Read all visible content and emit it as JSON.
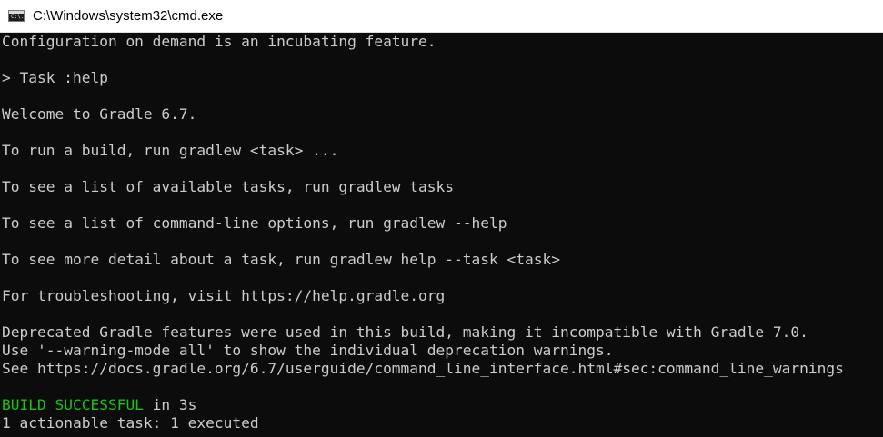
{
  "window": {
    "title": "C:\\Windows\\system32\\cmd.exe",
    "icon": "cmd-console-icon",
    "icon_text": "C:\\."
  },
  "console": {
    "lines": [
      "Configuration on demand is an incubating feature.",
      "> Task :help",
      "Welcome to Gradle 6.7.",
      "To run a build, run gradlew <task> ...",
      "To see a list of available tasks, run gradlew tasks",
      "To see a list of command-line options, run gradlew --help",
      "To see more detail about a task, run gradlew help --task <task>",
      "For troubleshooting, visit https://help.gradle.org",
      "Deprecated Gradle features were used in this build, making it incompatible with Gradle 7.0.",
      "Use '--warning-mode all' to show the individual deprecation warnings.",
      "See https://docs.gradle.org/6.7/userguide/command_line_interface.html#sec:command_line_warnings"
    ],
    "build_status": "BUILD SUCCESSFUL",
    "build_time": " in 3s",
    "summary": "1 actionable task: 1 executed"
  },
  "colors": {
    "background": "#0c0c0c",
    "text": "#cccccc",
    "success": "#16c60c",
    "titlebar": "#ffffff"
  }
}
